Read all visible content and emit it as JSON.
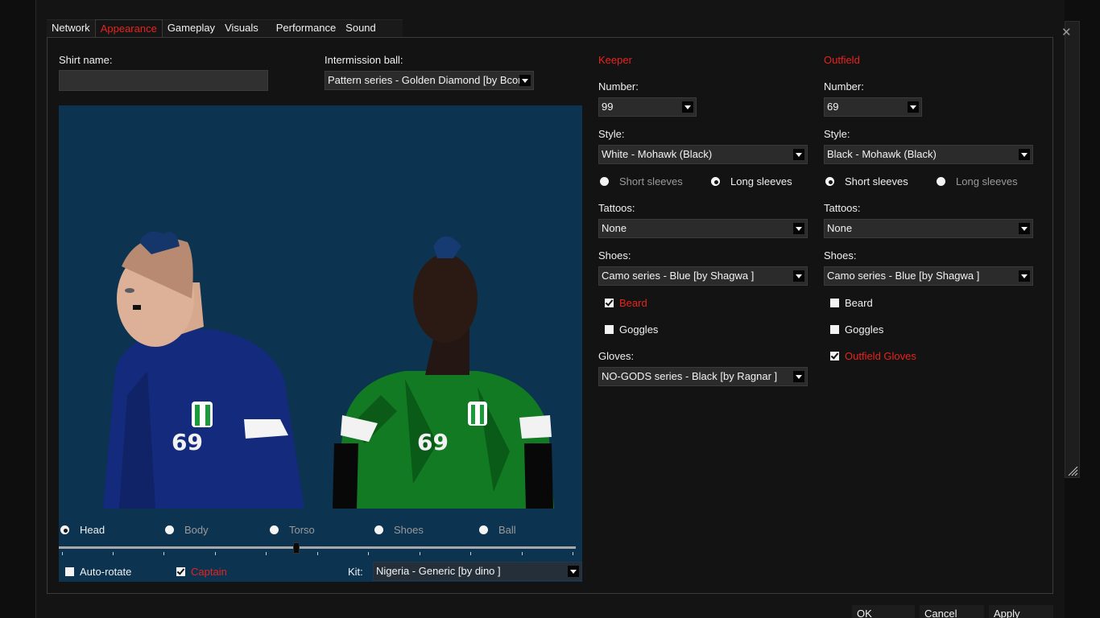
{
  "tabs": [
    "Network",
    "Appearance",
    "Gameplay",
    "Visuals",
    "Performance",
    "Sound"
  ],
  "shirt_name": {
    "label": "Shirt name:",
    "value": ""
  },
  "intermission_ball": {
    "label": "Intermission ball:",
    "value": "Pattern series - Golden Diamond   [by Bconj]"
  },
  "preview": {
    "left_player_number": "69",
    "right_player_number": "69",
    "parts": [
      "Head",
      "Body",
      "Torso",
      "Shoes",
      "Ball"
    ],
    "selected_part": "Head",
    "slider_value_fraction": 0.46,
    "auto_rotate_label": "Auto-rotate",
    "captain_label": "Captain",
    "kit_label": "Kit:",
    "kit_value": "Nigeria - Generic   [by dino ]"
  },
  "keeper": {
    "heading": "Keeper",
    "number_label": "Number:",
    "number_value": "99",
    "style_label": "Style:",
    "style_value": "White - Mohawk (Black)",
    "short_sleeves": "Short sleeves",
    "long_sleeves": "Long sleeves",
    "tattoos_label": "Tattoos:",
    "tattoos_value": "None",
    "shoes_label": "Shoes:",
    "shoes_value": "Camo series - Blue   [by Shagwa ]",
    "beard_label": "Beard",
    "goggles_label": "Goggles",
    "gloves_label": "Gloves:",
    "gloves_value": "NO-GODS series - Black   [by Ragnar ]"
  },
  "outfield": {
    "heading": "Outfield",
    "number_label": "Number:",
    "number_value": "69",
    "style_label": "Style:",
    "style_value": "Black - Mohawk (Black)",
    "short_sleeves": "Short sleeves",
    "long_sleeves": "Long sleeves",
    "tattoos_label": "Tattoos:",
    "tattoos_value": "None",
    "shoes_label": "Shoes:",
    "shoes_value": "Camo series - Blue   [by Shagwa ]",
    "beard_label": "Beard",
    "goggles_label": "Goggles",
    "gloves_label": "Outfield Gloves"
  },
  "buttons": {
    "ok": "OK",
    "cancel": "Cancel",
    "apply": "Apply"
  },
  "colors": {
    "accent_red": "#e8231d",
    "preview_bg": "#0c3350"
  }
}
